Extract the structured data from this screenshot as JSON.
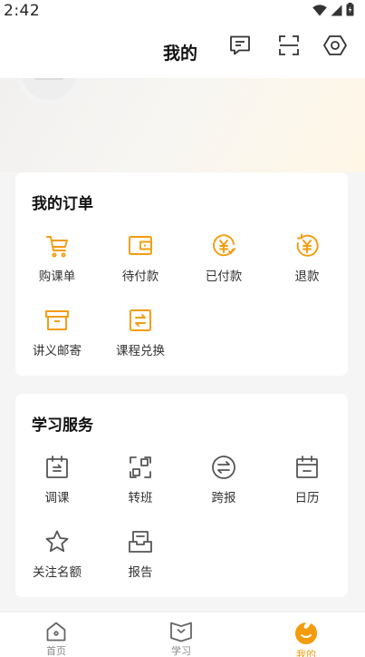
{
  "status_bar": {
    "time": "2:42",
    "icons": [
      "wifi-icon",
      "signal-icon",
      "battery-icon"
    ]
  },
  "header": {
    "title": "我的",
    "actions": [
      "message-icon",
      "scan-icon",
      "settings-icon"
    ]
  },
  "orders": {
    "title": "我的订单",
    "items": [
      {
        "label": "购课单",
        "icon": "cart-icon"
      },
      {
        "label": "待付款",
        "icon": "wallet-icon"
      },
      {
        "label": "已付款",
        "icon": "yen-check-icon"
      },
      {
        "label": "退款",
        "icon": "yen-refund-icon"
      },
      {
        "label": "讲义邮寄",
        "icon": "box-icon"
      },
      {
        "label": "课程兑换",
        "icon": "exchange-icon"
      }
    ]
  },
  "services": {
    "title": "学习服务",
    "items": [
      {
        "label": "调课",
        "icon": "calendar-swap-icon"
      },
      {
        "label": "转班",
        "icon": "transfer-class-icon"
      },
      {
        "label": "跨报",
        "icon": "cross-enroll-icon"
      },
      {
        "label": "日历",
        "icon": "calendar-icon"
      },
      {
        "label": "关注名额",
        "icon": "star-icon"
      },
      {
        "label": "报告",
        "icon": "report-icon"
      }
    ]
  },
  "tabs": [
    {
      "label": "首页",
      "icon": "home-icon",
      "active": false
    },
    {
      "label": "学习",
      "icon": "book-icon",
      "active": false
    },
    {
      "label": "我的",
      "icon": "profile-icon",
      "active": true
    }
  ],
  "colors": {
    "accent": "#f39c0d",
    "icon_gray": "#555555",
    "background": "#f5f5f6"
  }
}
